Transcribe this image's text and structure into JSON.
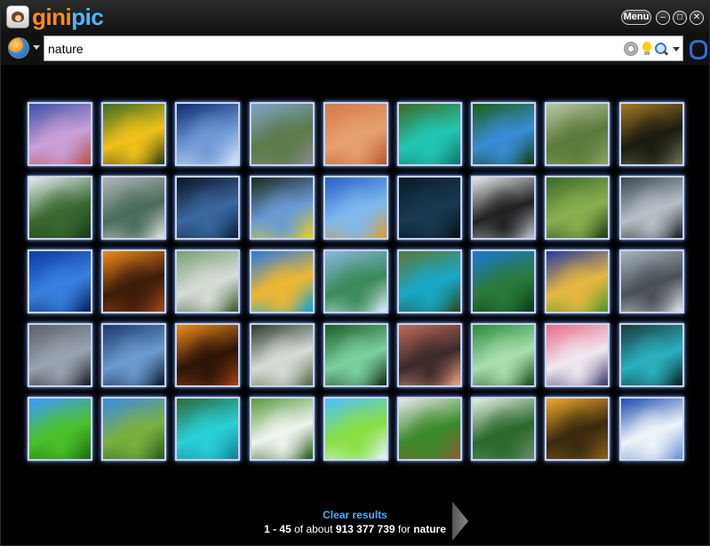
{
  "app": {
    "logo_part1": "gini",
    "logo_part2": "pic",
    "menu_label": "Menu",
    "minimize_glyph": "–",
    "maximize_glyph": "□",
    "close_glyph": "✕"
  },
  "search": {
    "value": "nature"
  },
  "thumbnails": [
    {
      "name": "canyon-sunset",
      "colors": [
        "#3c4fa8",
        "#c9a0d8",
        "#b4524a"
      ]
    },
    {
      "name": "sunflowers",
      "colors": [
        "#3d6b24",
        "#f2c21a",
        "#2d3d12"
      ]
    },
    {
      "name": "dandelion-sky",
      "colors": [
        "#0a2c6e",
        "#6f9ad6",
        "#d8e6f6"
      ]
    },
    {
      "name": "mountain-stream",
      "colors": [
        "#7fa3c8",
        "#5c7a4a",
        "#8a8a8a"
      ]
    },
    {
      "name": "hummingbird",
      "colors": [
        "#d67a48",
        "#e6a070",
        "#b85a30"
      ]
    },
    {
      "name": "green-lake",
      "colors": [
        "#3d6a2a",
        "#21c6b0",
        "#0e7a6e"
      ]
    },
    {
      "name": "blue-butterfly",
      "colors": [
        "#1b5e1a",
        "#3a8cd6",
        "#0e3e10"
      ]
    },
    {
      "name": "garden-path",
      "colors": [
        "#b8c6a0",
        "#5a7a3a",
        "#8aa060"
      ]
    },
    {
      "name": "reflection-lake",
      "colors": [
        "#a07a24",
        "#1a1a10",
        "#707050"
      ]
    },
    {
      "name": "river-cliffs",
      "colors": [
        "#e8ecf0",
        "#3a6a30",
        "#1a3a1a"
      ]
    },
    {
      "name": "old-barn",
      "colors": [
        "#b0b6b8",
        "#4a6a5a",
        "#e0e0e0"
      ]
    },
    {
      "name": "moon-sea",
      "colors": [
        "#081428",
        "#3a68a0",
        "#0a2040"
      ]
    },
    {
      "name": "yellow-flowers-forest",
      "colors": [
        "#1a2a1a",
        "#6a9ad6",
        "#e8d018"
      ]
    },
    {
      "name": "alpine-lake",
      "colors": [
        "#2a60c8",
        "#7eb8f0",
        "#d8a030"
      ]
    },
    {
      "name": "night-crescent",
      "colors": [
        "#0a1a2a",
        "#1a3a50",
        "#041018"
      ]
    },
    {
      "name": "penguins",
      "colors": [
        "#e6e8ec",
        "#202020",
        "#b8c0c8"
      ]
    },
    {
      "name": "forest-waterfall",
      "colors": [
        "#3a6a28",
        "#8ab050",
        "#1e3e12"
      ]
    },
    {
      "name": "storm-clouds",
      "colors": [
        "#3a4650",
        "#b8c0c8",
        "#1a2020"
      ]
    },
    {
      "name": "blue-coast",
      "colors": [
        "#0a3aa0",
        "#3a80e0",
        "#08205a"
      ]
    },
    {
      "name": "orange-canyon",
      "colors": [
        "#f08a1a",
        "#3a1a0a",
        "#a04a14"
      ]
    },
    {
      "name": "rocky-river",
      "colors": [
        "#7aa070",
        "#d8dcd8",
        "#3a5a2a"
      ]
    },
    {
      "name": "desert-pools",
      "colors": [
        "#2a78e0",
        "#f0b830",
        "#12a0d8"
      ]
    },
    {
      "name": "calm-lake",
      "colors": [
        "#88b8e0",
        "#3a8a5a",
        "#d8ecf8"
      ]
    },
    {
      "name": "cascade",
      "colors": [
        "#5a7a3a",
        "#18a8c8",
        "#2a4a20"
      ]
    },
    {
      "name": "jungle-blue",
      "colors": [
        "#1a78d8",
        "#2a7a3a",
        "#0a3a1a"
      ]
    },
    {
      "name": "green-field-sunset",
      "colors": [
        "#2a3aa0",
        "#e8b840",
        "#4a9a28"
      ]
    },
    {
      "name": "misty-branch",
      "colors": [
        "#a8b4bc",
        "#4a5058",
        "#e0e4e8"
      ]
    },
    {
      "name": "lightning",
      "colors": [
        "#5a6068",
        "#9aa4b0",
        "#1a1e22"
      ]
    },
    {
      "name": "blue-storm",
      "colors": [
        "#1a3a6a",
        "#6a9ad0",
        "#0a1a30"
      ]
    },
    {
      "name": "palm-sunset",
      "colors": [
        "#f08a1a",
        "#2a1408",
        "#a04010"
      ]
    },
    {
      "name": "waterfall-cliff",
      "colors": [
        "#2a3a2a",
        "#d8dcd8",
        "#5a6a4a"
      ]
    },
    {
      "name": "green-waterfall",
      "colors": [
        "#1e5a2a",
        "#7ad0a0",
        "#0e3016"
      ]
    },
    {
      "name": "rocky-sunset",
      "colors": [
        "#c06a5a",
        "#3a2a2a",
        "#f0a080"
      ]
    },
    {
      "name": "mossy-falls",
      "colors": [
        "#2a8a3a",
        "#a8e0b0",
        "#144a1a"
      ]
    },
    {
      "name": "pink-winter",
      "colors": [
        "#e86a8a",
        "#f0e8f0",
        "#3a3a6a"
      ]
    },
    {
      "name": "teal-waterfall",
      "colors": [
        "#1a3a3a",
        "#2ab0c0",
        "#0a2020"
      ]
    },
    {
      "name": "meadow-stream",
      "colors": [
        "#3a9aff",
        "#4ac028",
        "#1e6a14"
      ]
    },
    {
      "name": "lone-tree",
      "colors": [
        "#3a8ae8",
        "#7ab040",
        "#2a5a18"
      ]
    },
    {
      "name": "turquoise-pool",
      "colors": [
        "#2a6a3a",
        "#2ad0d8",
        "#108090"
      ]
    },
    {
      "name": "white-flowers",
      "colors": [
        "#5a9a3a",
        "#f0f4f0",
        "#2a5a1a"
      ]
    },
    {
      "name": "cartoon-hills",
      "colors": [
        "#4ac0ff",
        "#8ae040",
        "#e0f4ff"
      ]
    },
    {
      "name": "elf-character",
      "colors": [
        "#e8e8e8",
        "#3a8a28",
        "#8a5a3a"
      ]
    },
    {
      "name": "palm-canopy",
      "colors": [
        "#e8f0e8",
        "#2a6a2a",
        "#6a8a6a"
      ]
    },
    {
      "name": "golden-forest",
      "colors": [
        "#f0a82a",
        "#3a2a10",
        "#8a6018"
      ]
    },
    {
      "name": "snowy-peaks",
      "colors": [
        "#1a4ab0",
        "#f0f4f8",
        "#6a90d0"
      ]
    }
  ],
  "footer": {
    "clear_label": "Clear results",
    "range": "1 - 45",
    "of_about": " of about ",
    "total": "913 377 739",
    "for_text": " for ",
    "query": "nature"
  }
}
